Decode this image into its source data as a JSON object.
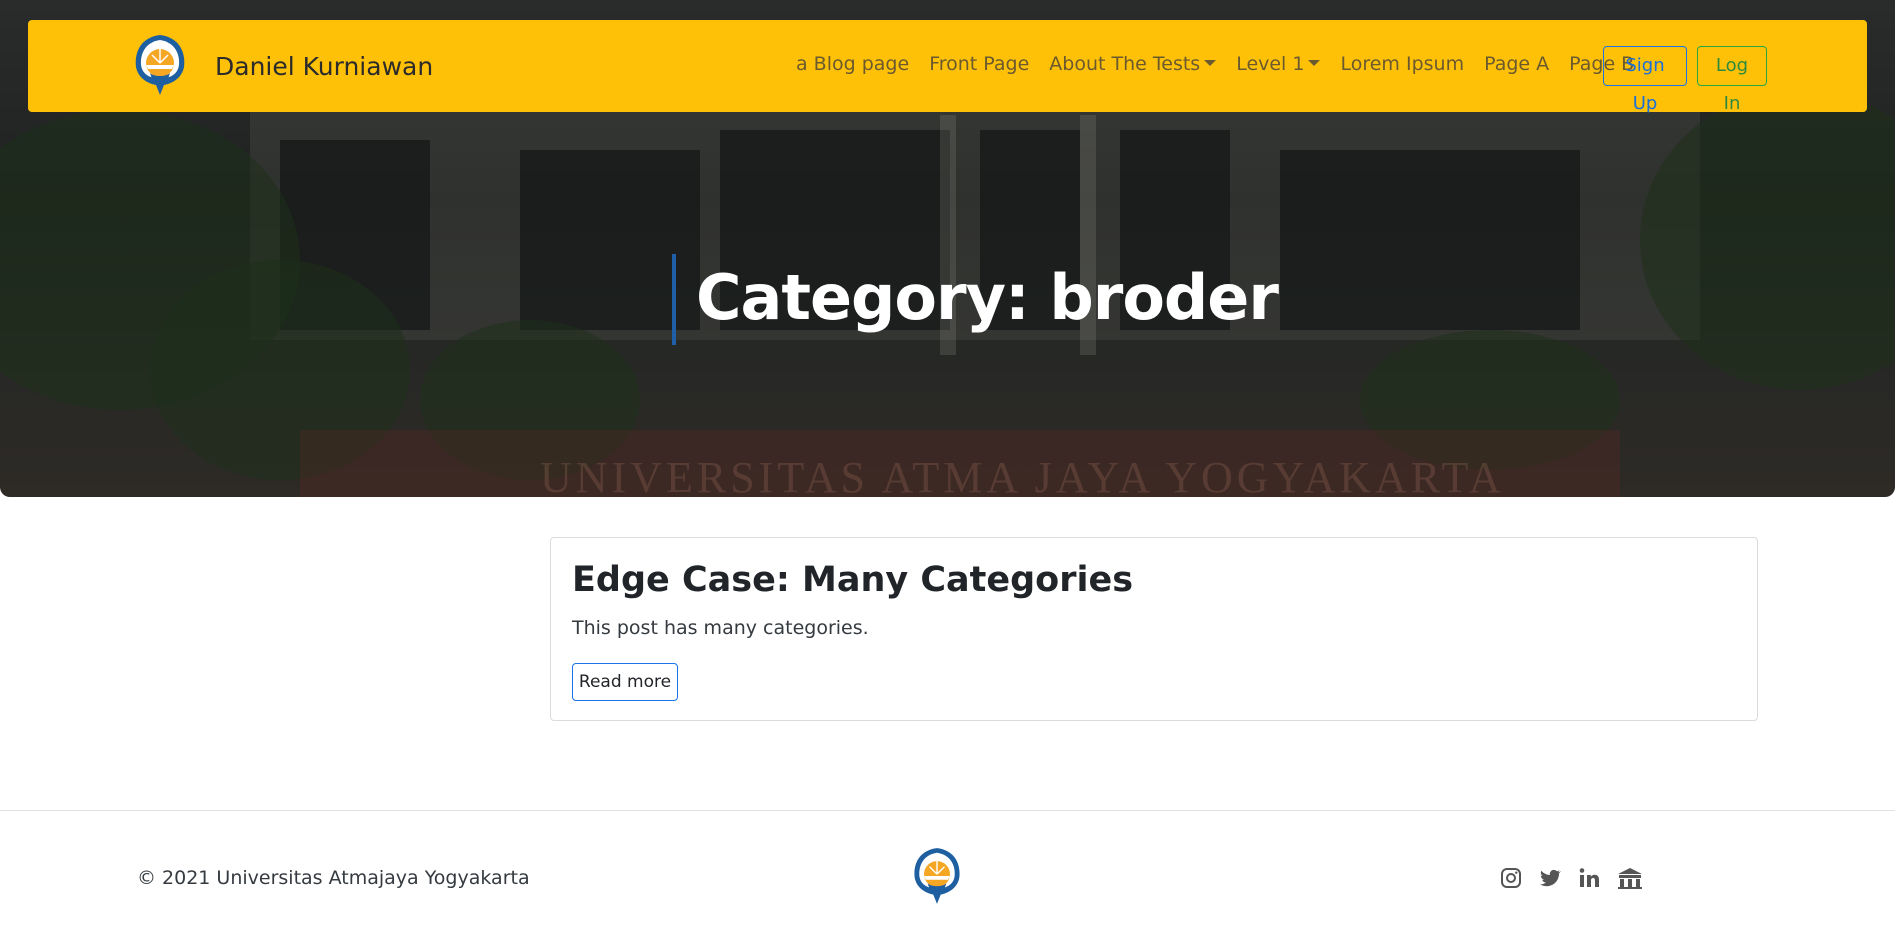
{
  "navbar": {
    "brand_name": "Daniel Kurniawan",
    "brand_logo": "university-emblem",
    "background_color": "#ffc107",
    "links": [
      {
        "label": "a Blog page",
        "dropdown": false
      },
      {
        "label": "Front Page",
        "dropdown": false
      },
      {
        "label": "About The Tests",
        "dropdown": true
      },
      {
        "label": "Level 1",
        "dropdown": true
      },
      {
        "label": "Lorem Ipsum",
        "dropdown": false
      },
      {
        "label": "Page A",
        "dropdown": false
      },
      {
        "label": "Page B",
        "dropdown": false
      }
    ],
    "signup_label": "Sign Up",
    "login_label": "Log In"
  },
  "hero": {
    "title": "Category: broder",
    "accent_color": "#1e5fa8",
    "background_sign_text": "UNIVERSITAS ATMA JAYA YOGYAKARTA"
  },
  "posts": [
    {
      "title": "Edge Case: Many Categories",
      "excerpt": "This post has many categories.",
      "read_more_label": "Read more"
    }
  ],
  "footer": {
    "copyright": "© 2021 Universitas Atmajaya Yogyakarta",
    "logo": "university-emblem",
    "social_icons": [
      "instagram-icon",
      "twitter-icon",
      "linkedin-icon",
      "campus-icon"
    ]
  }
}
